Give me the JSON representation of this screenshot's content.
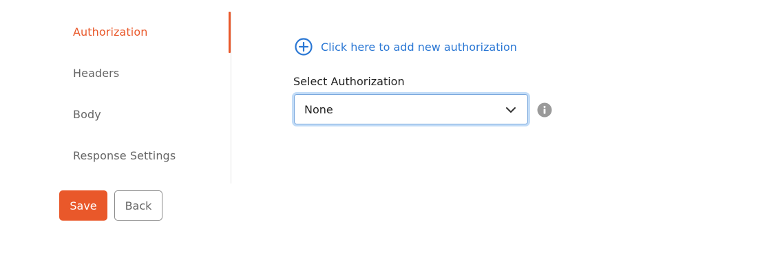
{
  "sidebar": {
    "items": [
      {
        "label": "Authorization",
        "active": true
      },
      {
        "label": "Headers",
        "active": false
      },
      {
        "label": "Body",
        "active": false
      },
      {
        "label": "Response Settings",
        "active": false
      }
    ]
  },
  "actions": {
    "save_label": "Save",
    "back_label": "Back"
  },
  "main": {
    "add_link_label": "Click here to add new authorization",
    "add_link_icon": "plus-circle-icon",
    "select_label": "Select Authorization",
    "select_value": "None",
    "select_icon": "chevron-down-icon",
    "info_icon": "info-icon"
  },
  "colors": {
    "accent": "#e9582a",
    "link": "#2a77d4",
    "text": "#222222",
    "muted": "#666666",
    "focus_ring": "#c2dcf7",
    "info_icon": "#9a9a9a"
  }
}
